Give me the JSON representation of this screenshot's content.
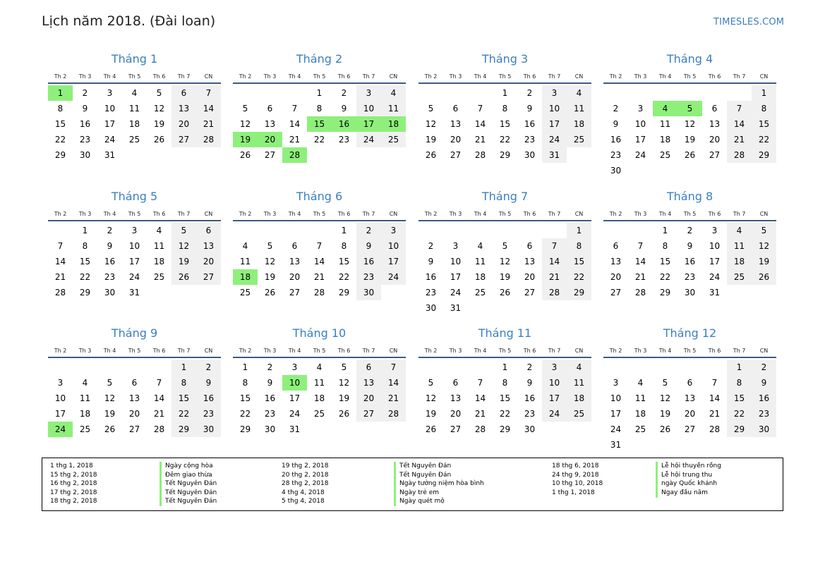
{
  "header": {
    "title": "Lịch năm 2018. (Đài loan)",
    "brand": "TIMESLES.COM"
  },
  "weekdays": [
    "Th 2",
    "Th 3",
    "Th 4",
    "Th 5",
    "Th 6",
    "Th 7",
    "CN"
  ],
  "colors": {
    "accent": "#3a7fc0",
    "holiday": "#8ef07b",
    "weekend": "#f0f0f0",
    "rule": "#3d5a80"
  },
  "months": [
    {
      "name": "Tháng 1",
      "offset": 0,
      "days": 31,
      "holidays": [
        1
      ]
    },
    {
      "name": "Tháng 2",
      "offset": 3,
      "days": 28,
      "holidays": [
        15,
        16,
        17,
        18,
        19,
        20,
        28
      ]
    },
    {
      "name": "Tháng 3",
      "offset": 3,
      "days": 31,
      "holidays": []
    },
    {
      "name": "Tháng 4",
      "offset": 6,
      "days": 30,
      "holidays": [
        4,
        5
      ]
    },
    {
      "name": "Tháng 5",
      "offset": 1,
      "days": 31,
      "holidays": []
    },
    {
      "name": "Tháng 6",
      "offset": 4,
      "days": 30,
      "holidays": [
        18
      ]
    },
    {
      "name": "Tháng 7",
      "offset": 6,
      "days": 31,
      "holidays": []
    },
    {
      "name": "Tháng 8",
      "offset": 2,
      "days": 31,
      "holidays": []
    },
    {
      "name": "Tháng 9",
      "offset": 5,
      "days": 30,
      "holidays": [
        24
      ]
    },
    {
      "name": "Tháng 10",
      "offset": 0,
      "days": 31,
      "holidays": [
        10
      ]
    },
    {
      "name": "Tháng 11",
      "offset": 3,
      "days": 30,
      "holidays": []
    },
    {
      "name": "Tháng 12",
      "offset": 5,
      "days": 31,
      "holidays": []
    }
  ],
  "legend": [
    [
      {
        "date": "1 thg 1, 2018",
        "name": "Ngày cộng hòa"
      },
      {
        "date": "15 thg 2, 2018",
        "name": "Đêm giao thừa"
      },
      {
        "date": "16 thg 2, 2018",
        "name": "Tết Nguyên Đán"
      },
      {
        "date": "17 thg 2, 2018",
        "name": "Tết Nguyên Đán"
      },
      {
        "date": "18 thg 2, 2018",
        "name": "Tết Nguyên Đán"
      }
    ],
    [
      {
        "date": "19 thg 2, 2018",
        "name": "Tết Nguyên Đán"
      },
      {
        "date": "20 thg 2, 2018",
        "name": "Tết Nguyên Đán"
      },
      {
        "date": "28 thg 2, 2018",
        "name": "Ngày tưởng niệm hòa bình"
      },
      {
        "date": "4 thg 4, 2018",
        "name": "Ngày trẻ em"
      },
      {
        "date": "5 thg 4, 2018",
        "name": "Ngày quét mộ"
      }
    ],
    [
      {
        "date": "18 thg 6, 2018",
        "name": "Lễ hội thuyền rồng"
      },
      {
        "date": "24 thg 9, 2018",
        "name": "Lễ hội trung thu"
      },
      {
        "date": "10 thg 10, 2018",
        "name": "ngày Quốc khánh"
      },
      {
        "date": "1 thg 1, 2018",
        "name": "Ngay đầu năm"
      }
    ]
  ]
}
